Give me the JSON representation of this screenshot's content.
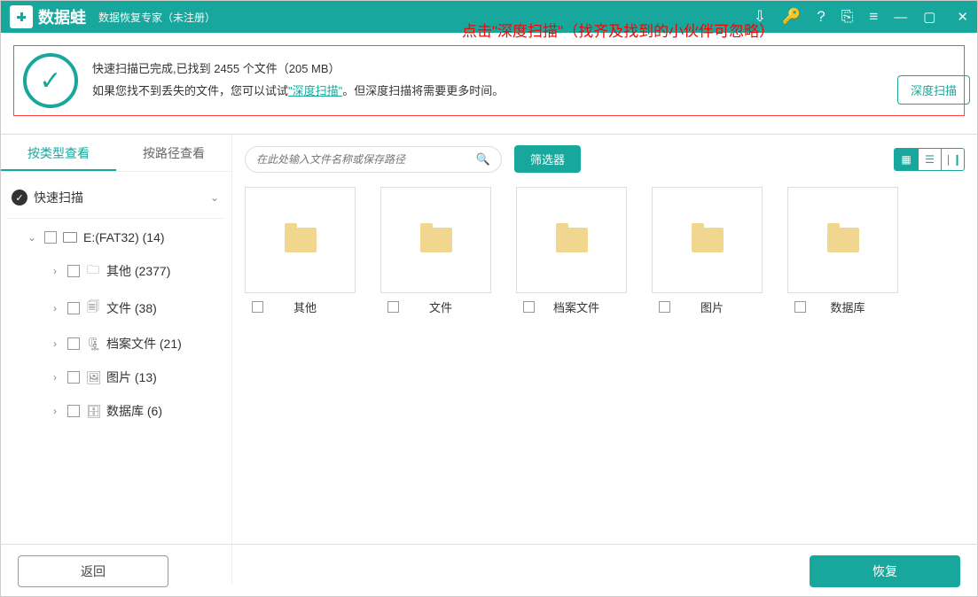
{
  "title": {
    "logo": "数据蛙",
    "subtitle": "数据恢复专家（未注册）"
  },
  "banner": {
    "line1": "快速扫描已完成,已找到 2455 个文件（205 MB）",
    "line2a": "如果您找不到丢失的文件，您可以试试",
    "link": "\"深度扫描\"",
    "line2b": "。但深度扫描将需要更多时间。",
    "deep_btn": "深度扫描",
    "annotation": "点击\"深度扫描\"（找齐及找到的小伙伴可忽略）"
  },
  "tabs": {
    "byType": "按类型查看",
    "byPath": "按路径查看"
  },
  "tree": {
    "quick": "快速扫描",
    "drive": "E:(FAT32) (14)",
    "items": [
      {
        "label": "其他 (2377)",
        "icon": "🗀"
      },
      {
        "label": "文件 (38)",
        "icon": "🗐"
      },
      {
        "label": "档案文件 (21)",
        "icon": "🗜"
      },
      {
        "label": "图片 (13)",
        "icon": "🖼"
      },
      {
        "label": "数据库 (6)",
        "icon": "🗄"
      }
    ]
  },
  "toolbar": {
    "placeholder": "在此处输入文件名称或保存路径",
    "filter": "筛选器"
  },
  "grid": [
    {
      "name": "其他"
    },
    {
      "name": "文件"
    },
    {
      "name": "档案文件"
    },
    {
      "name": "图片"
    },
    {
      "name": "数据库"
    }
  ],
  "footer": {
    "back": "返回",
    "recover": "恢复"
  }
}
